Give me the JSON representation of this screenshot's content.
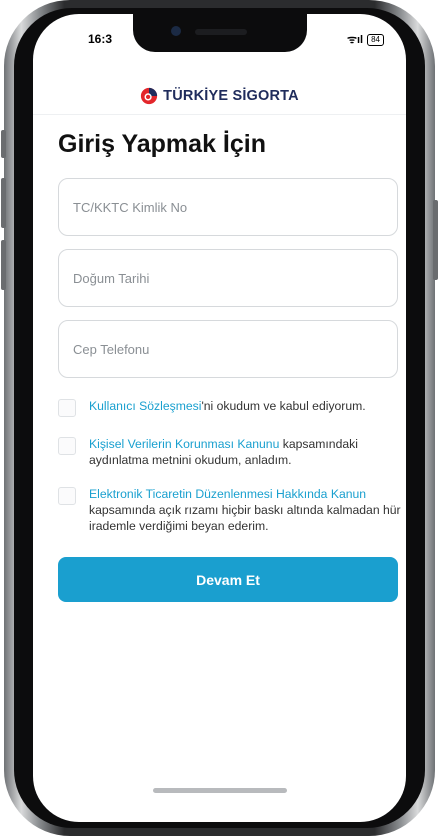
{
  "status_bar": {
    "time": "16:3",
    "signal": "ᯤıl",
    "battery": "84"
  },
  "brand": {
    "name": "TÜRKİYE SİGORTA",
    "logo_icon": "turkiye-sigorta-logo-icon",
    "colors": {
      "blue": "#1f2c5c",
      "red": "#e3262b"
    }
  },
  "page": {
    "title": "Giriş Yapmak İçin"
  },
  "form": {
    "tc_field": {
      "placeholder": "TC/KKTC Kimlik No",
      "value": ""
    },
    "birth_field": {
      "placeholder": "Doğum Tarihi",
      "value": ""
    },
    "phone_field": {
      "placeholder": "Cep Telefonu",
      "value": ""
    }
  },
  "consents": [
    {
      "link": "Kullanıcı Sözleşmesi",
      "text": "'ni okudum ve kabul ediyorum.",
      "checked": false
    },
    {
      "link": "Kişisel Verilerin Korunması Kanunu",
      "text": " kapsamındaki aydınlatma metnini okudum, anladım.",
      "checked": false
    },
    {
      "link": "Elektronik Ticaretin Düzenlenmesi Hakkında Kanun",
      "text": " kapsamında açık rızamı hiçbir baskı altında kalmadan hür irademle verdiğimi beyan ederim.",
      "checked": false
    }
  ],
  "cta": {
    "label": "Devam Et",
    "color": "#1a9fcf"
  },
  "colors": {
    "accent": "#1aa0cf",
    "frame": "#0c0c0d"
  }
}
